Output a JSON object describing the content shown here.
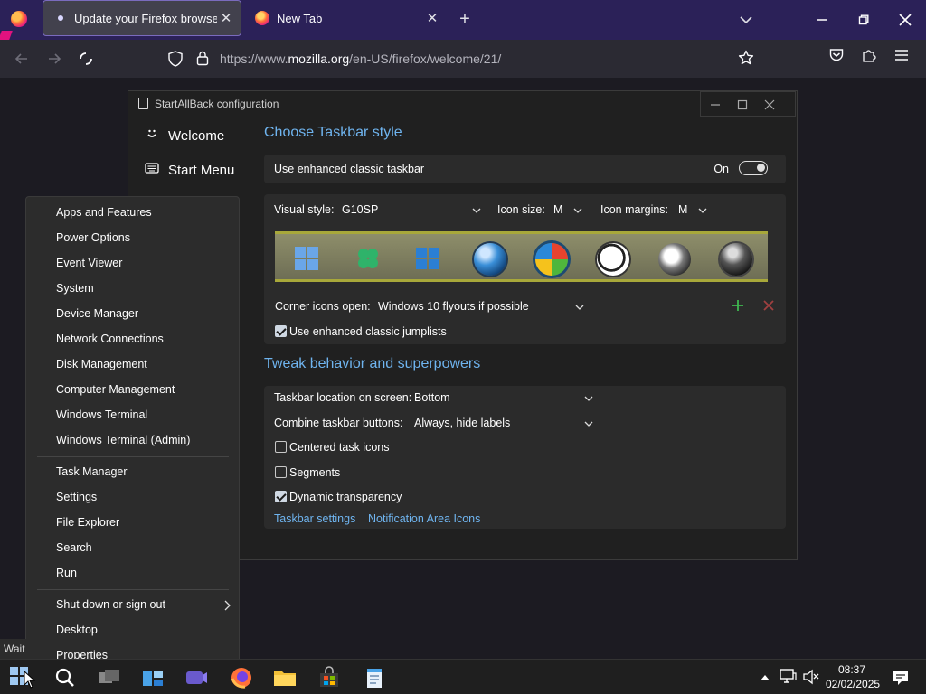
{
  "browser": {
    "tabs": [
      {
        "title": "Update your Firefox browser",
        "active": true
      },
      {
        "title": "New Tab",
        "active": false
      }
    ],
    "url_prefix": "https://www.",
    "url_host": "mozilla.org",
    "url_path": "/en-US/firefox/welcome/21/"
  },
  "sab": {
    "title": "StartAllBack configuration",
    "nav": [
      {
        "label": "Welcome",
        "icon": "smiley-icon"
      },
      {
        "label": "Start Menu",
        "icon": "keyboard-icon"
      }
    ],
    "section1_title": "Choose Taskbar style",
    "enhanced_label": "Use enhanced classic taskbar",
    "toggle_state": "On",
    "visual_style_label": "Visual style:",
    "visual_style_value": "G10SP",
    "icon_size_label": "Icon size:",
    "icon_size_value": "M",
    "icon_margins_label": "Icon margins:",
    "icon_margins_value": "M",
    "corner_label": "Corner icons open:",
    "corner_value": "Windows 10 flyouts if possible",
    "jumplists_label": "Use enhanced classic jumplists",
    "section2_title": "Tweak behavior and superpowers",
    "location_label": "Taskbar location on screen:",
    "location_value": "Bottom",
    "combine_label": "Combine taskbar buttons:",
    "combine_value": "Always, hide labels",
    "centered_label": "Centered task icons",
    "segments_label": "Segments",
    "transparency_label": "Dynamic transparency",
    "link_taskbar": "Taskbar settings",
    "link_notif": "Notification Area Icons"
  },
  "context_menu": {
    "group1": [
      "Apps and Features",
      "Power Options",
      "Event Viewer",
      "System",
      "Device Manager",
      "Network Connections",
      "Disk Management",
      "Computer Management",
      "Windows Terminal",
      "Windows Terminal (Admin)"
    ],
    "group2": [
      "Task Manager",
      "Settings",
      "File Explorer",
      "Search",
      "Run"
    ],
    "group3": [
      "Shut down or sign out",
      "Desktop",
      "Properties"
    ]
  },
  "tooltip": "Wait",
  "clock": {
    "time": "08:37",
    "date": "02/02/2025"
  }
}
